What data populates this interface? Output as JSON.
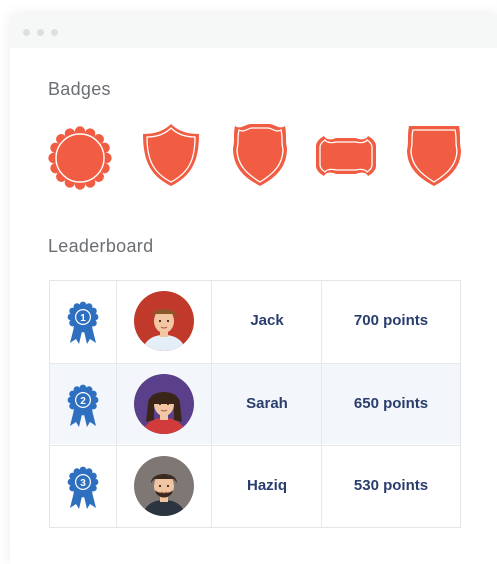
{
  "window": {
    "title_dots": 3
  },
  "badges": {
    "title": "Badges",
    "color": "#f15d42",
    "items": [
      {
        "shape": "scalloped-circle"
      },
      {
        "shape": "shield"
      },
      {
        "shape": "crest"
      },
      {
        "shape": "plaque"
      },
      {
        "shape": "heater-shield"
      }
    ]
  },
  "leaderboard": {
    "title": "Leaderboard",
    "ribbon_color": "#2f6fc0",
    "rows": [
      {
        "rank": "1",
        "name": "Jack",
        "points": "700 points",
        "avatar_bg": "#c0392b"
      },
      {
        "rank": "2",
        "name": "Sarah",
        "points": "650 points",
        "avatar_bg": "#5a3f8a"
      },
      {
        "rank": "3",
        "name": "Haziq",
        "points": "530 points",
        "avatar_bg": "#7f7774"
      }
    ]
  }
}
